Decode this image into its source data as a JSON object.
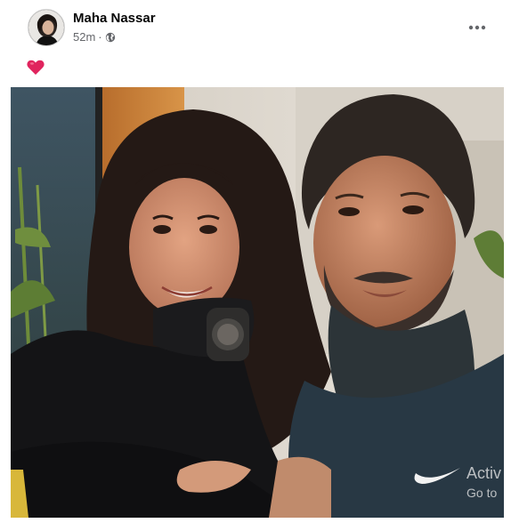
{
  "post": {
    "author_name": "Maha Nassar",
    "timestamp": "52m",
    "separator": "·",
    "privacy_icon": "globe-icon",
    "more_icon": "more-horizontal-icon",
    "reaction_icon": "red-heart-icon",
    "caption_emoji": "❤️"
  },
  "photo": {
    "watermark_line1": "Activ",
    "watermark_line2": "Go to"
  },
  "colors": {
    "author_text": "#050505",
    "meta_text": "#65676b",
    "heart": "#e0245e",
    "card_bg": "#ffffff"
  }
}
